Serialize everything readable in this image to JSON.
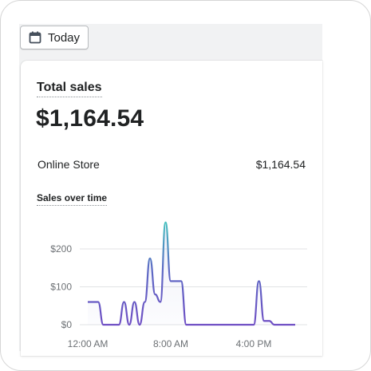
{
  "date_picker": {
    "label": "Today",
    "icon": "calendar-icon"
  },
  "total_sales": {
    "title": "Total sales",
    "value": "$1,164.54",
    "breakdown": [
      {
        "channel": "Online Store",
        "amount": "$1,164.54"
      }
    ]
  },
  "chart_data": {
    "type": "line",
    "title": "Sales over time",
    "x_labels": [
      "12:00 AM",
      "8:00 AM",
      "4:00 PM"
    ],
    "x_label_hours": [
      0,
      8,
      16
    ],
    "y_ticks": [
      {
        "value": 0,
        "label": "$0"
      },
      {
        "value": 100,
        "label": "$100"
      },
      {
        "value": 200,
        "label": "$200"
      }
    ],
    "ylim": [
      0,
      260
    ],
    "grid": true,
    "series": [
      {
        "color": "#5c6ac4",
        "x": [
          0,
          1,
          1.5,
          2,
          3,
          3.5,
          4,
          4.5,
          5,
          5.5,
          6,
          6.5,
          7,
          7.5,
          8,
          8.5,
          9,
          9.5,
          10,
          10.5,
          11,
          11.5,
          12,
          13,
          14,
          15,
          16,
          16.5,
          17,
          17.5,
          18,
          19,
          20
        ],
        "values": [
          60,
          60,
          0,
          0,
          0,
          60,
          0,
          60,
          0,
          60,
          175,
          80,
          60,
          270,
          115,
          115,
          115,
          0,
          0,
          0,
          0,
          0,
          0,
          0,
          0,
          0,
          0,
          115,
          10,
          10,
          0,
          0,
          0
        ]
      }
    ]
  }
}
